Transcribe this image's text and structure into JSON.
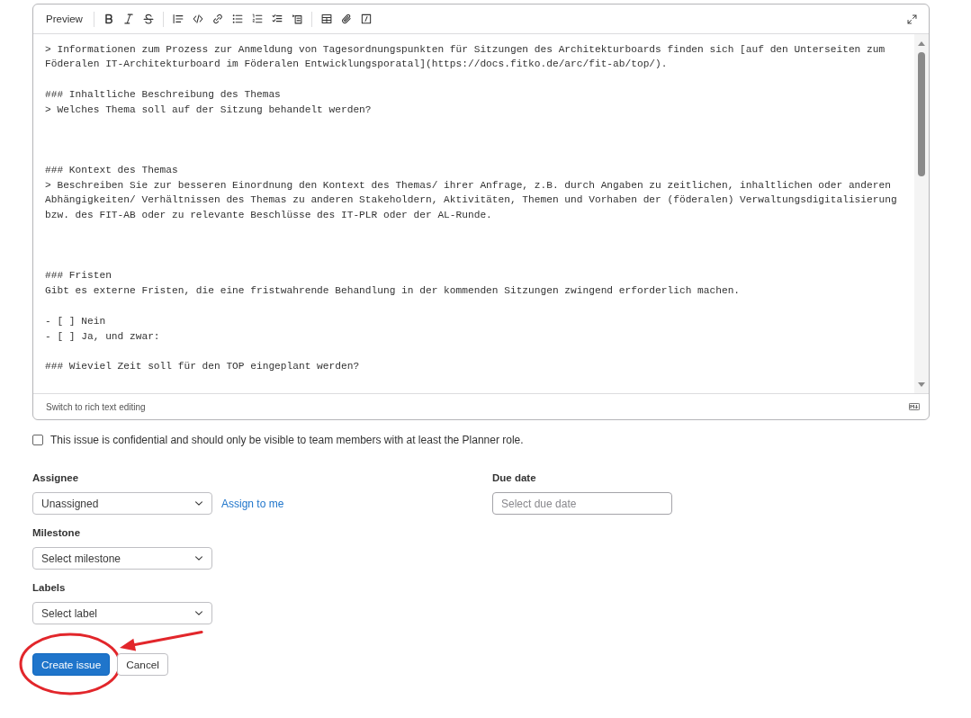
{
  "editor": {
    "toolbar": {
      "preview": "Preview",
      "tools": [
        {
          "kind": "divider"
        },
        {
          "kind": "bold"
        },
        {
          "kind": "italic"
        },
        {
          "kind": "strikethrough"
        },
        {
          "kind": "divider"
        },
        {
          "kind": "quote"
        },
        {
          "kind": "code"
        },
        {
          "kind": "link"
        },
        {
          "kind": "bullet-list"
        },
        {
          "kind": "numbered-list"
        },
        {
          "kind": "task-list"
        },
        {
          "kind": "collapsible"
        },
        {
          "kind": "divider"
        },
        {
          "kind": "table"
        },
        {
          "kind": "attach"
        },
        {
          "kind": "slash-command"
        }
      ]
    },
    "lines": [
      {
        "kind": "text",
        "text": "> Informationen zum Prozess zur Anmeldung von Tagesordnungspunkten für Sitzungen des Architekturboards finden sich [auf den Unterseiten zum"
      },
      {
        "kind": "text",
        "text": "Föderalen IT-Architekturboard im Föderalen Entwicklungsporatal](https://docs.fitko.de/arc/fit-ab/top/)."
      },
      {
        "kind": "blank"
      },
      {
        "kind": "text",
        "text": "### Inhaltliche Beschreibung des Themas"
      },
      {
        "kind": "text",
        "text": "> Welches Thema soll auf der Sitzung behandelt werden?"
      },
      {
        "kind": "blank"
      },
      {
        "kind": "blank"
      },
      {
        "kind": "blank"
      },
      {
        "kind": "text",
        "text": "### Kontext des Themas"
      },
      {
        "kind": "text",
        "text": "> Beschreiben Sie zur besseren Einordnung den Kontext des Themas/ ihrer Anfrage, z.B. durch Angaben zu zeitlichen, inhaltlichen oder anderen"
      },
      {
        "kind": "text",
        "text": "Abhängigkeiten/ Verhältnissen des Themas zu anderen Stakeholdern, Aktivitäten, Themen und Vorhaben der (föderalen) Verwaltungsdigitalisierung"
      },
      {
        "kind": "text",
        "text": "bzw. des FIT-AB oder zu relevante Beschlüsse des IT-PLR oder der AL-Runde."
      },
      {
        "kind": "blank"
      },
      {
        "kind": "blank"
      },
      {
        "kind": "blank"
      },
      {
        "kind": "text",
        "text": "### Fristen"
      },
      {
        "kind": "text",
        "text": "Gibt es externe Fristen, die eine fristwahrende Behandlung in der kommenden Sitzungen zwingend erforderlich machen."
      },
      {
        "kind": "blank"
      },
      {
        "kind": "text",
        "text": "- [ ] Nein"
      },
      {
        "kind": "text",
        "text": "- [ ] Ja, und zwar:"
      },
      {
        "kind": "blank"
      },
      {
        "kind": "text",
        "text": "### Wieviel Zeit soll für den TOP eingeplant werden?"
      }
    ],
    "footer_link": "Switch to rich text editing"
  },
  "confidential": {
    "label": "This issue is confidential and should only be visible to team members with at least the Planner role.",
    "checked": false
  },
  "assignee": {
    "label": "Assignee",
    "value": "Unassigned",
    "link": "Assign to me"
  },
  "due_date": {
    "label": "Due date",
    "placeholder": "Select due date"
  },
  "milestone": {
    "label": "Milestone",
    "value": "Select milestone"
  },
  "labels": {
    "label": "Labels",
    "value": "Select label"
  },
  "buttons": [
    {
      "label": "Create issue",
      "kind": "primary",
      "highlighted": true
    },
    {
      "label": "Cancel",
      "kind": "secondary",
      "highlighted": false
    }
  ]
}
